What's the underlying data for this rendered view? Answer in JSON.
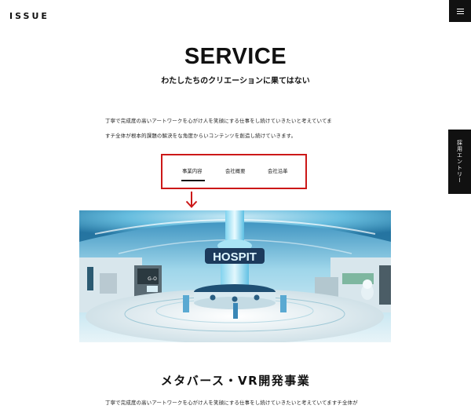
{
  "header": {
    "logo": "ISSUE"
  },
  "side": {
    "entry_label": "採用エントリー"
  },
  "service": {
    "title": "SERVICE",
    "subtitle": "わたしたちのクリエーションに果てはない",
    "intro_line1": "丁寧で完成度の高いアートワークを心がけ人を笑顔にする仕事をし続けていきたいと考えていてま",
    "intro_line2": "すチ全体が根本的課題の解決をな角度からいコンテンツを創造し続けていきます。"
  },
  "tabs": [
    {
      "label": "事業内容",
      "active": true
    },
    {
      "label": "会社概要",
      "active": false
    },
    {
      "label": "会社沿革",
      "active": false
    }
  ],
  "hero": {
    "sign_text": "HOSPIT",
    "screen_text": "G-O"
  },
  "section": {
    "heading": "メタバース・VR開発事業",
    "body": "丁寧で完成度の高いアートワークを心がけ人を笑顔にする仕事をし続けていきたいと考えていてますチ全体が"
  },
  "colors": {
    "highlight_box": "#cc1818",
    "dark": "#111111"
  }
}
